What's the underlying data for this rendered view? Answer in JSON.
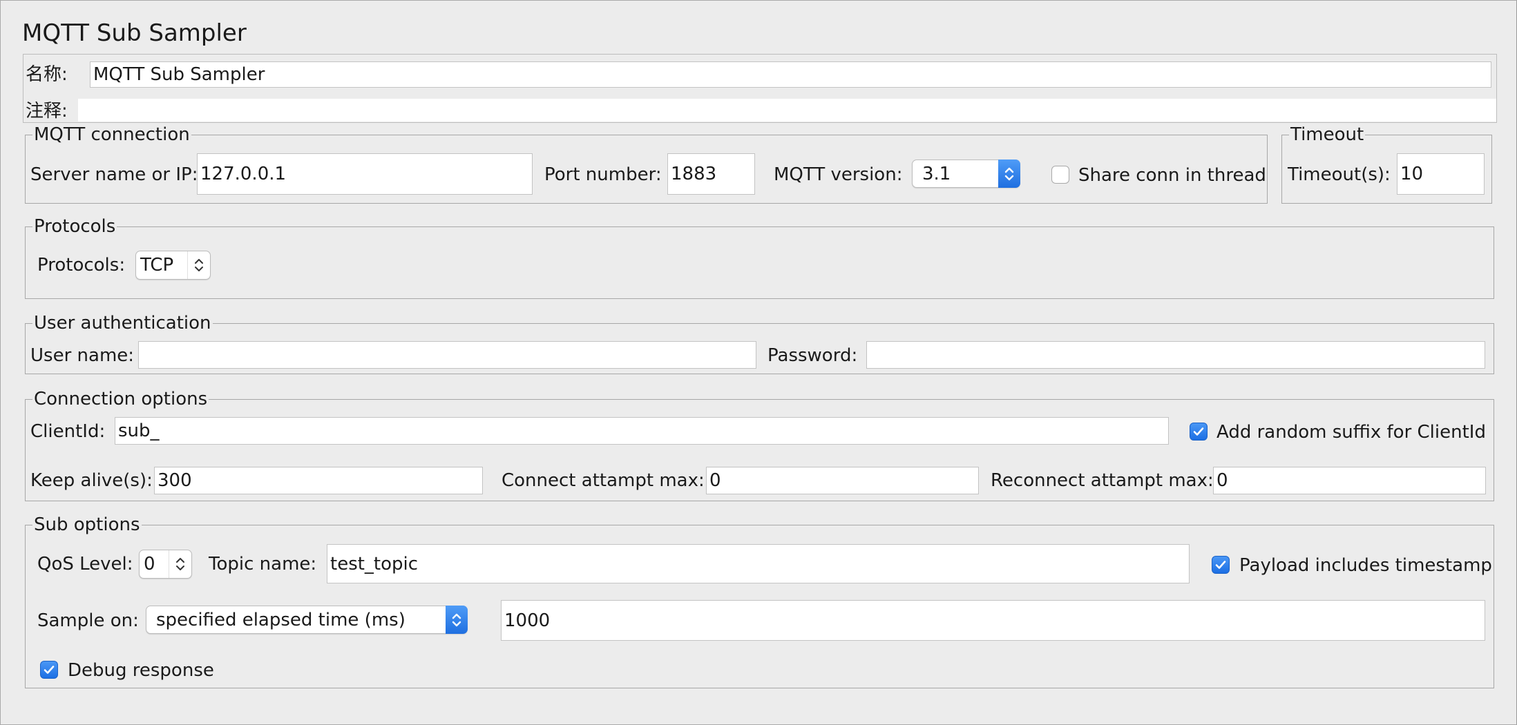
{
  "panel": {
    "title": "MQTT Sub Sampler"
  },
  "name_section": {
    "name_label": "名称:",
    "name_value": "MQTT Sub Sampler",
    "comment_label": "注释:",
    "comment_value": ""
  },
  "mqtt_connection": {
    "legend": "MQTT connection",
    "server_label": "Server name or IP:",
    "server_value": "127.0.0.1",
    "port_label": "Port number:",
    "port_value": "1883",
    "version_label": "MQTT version:",
    "version_value": "3.1",
    "share_conn_label": "Share conn in thread",
    "share_conn_checked": false
  },
  "timeout": {
    "legend": "Timeout",
    "timeout_label": "Timeout(s):",
    "timeout_value": "10"
  },
  "protocols": {
    "legend": "Protocols",
    "protocols_label": "Protocols:",
    "protocols_value": "TCP"
  },
  "user_auth": {
    "legend": "User authentication",
    "username_label": "User name:",
    "username_value": "",
    "password_label": "Password:",
    "password_value": ""
  },
  "connection_options": {
    "legend": "Connection options",
    "clientid_label": "ClientId:",
    "clientid_value": "sub_",
    "random_suffix_label": "Add random suffix for ClientId",
    "random_suffix_checked": true,
    "keepalive_label": "Keep alive(s):",
    "keepalive_value": "300",
    "connect_max_label": "Connect attampt max:",
    "connect_max_value": "0",
    "reconnect_max_label": "Reconnect attampt max:",
    "reconnect_max_value": "0"
  },
  "sub_options": {
    "legend": "Sub options",
    "qos_label": "QoS Level:",
    "qos_value": "0",
    "topic_label": "Topic name:",
    "topic_value": "test_topic",
    "payload_ts_label": "Payload includes timestamp",
    "payload_ts_checked": true,
    "sample_on_label": "Sample on:",
    "sample_on_value": "specified elapsed time (ms)",
    "elapsed_value": "1000",
    "debug_label": "Debug response",
    "debug_checked": true
  },
  "colors": {
    "accent": "#2a7ff0",
    "background": "#ececec",
    "border": "#a7a7a7"
  },
  "icons": {
    "checkmark": "checkmark-icon",
    "updown": "updown-arrows-icon"
  }
}
